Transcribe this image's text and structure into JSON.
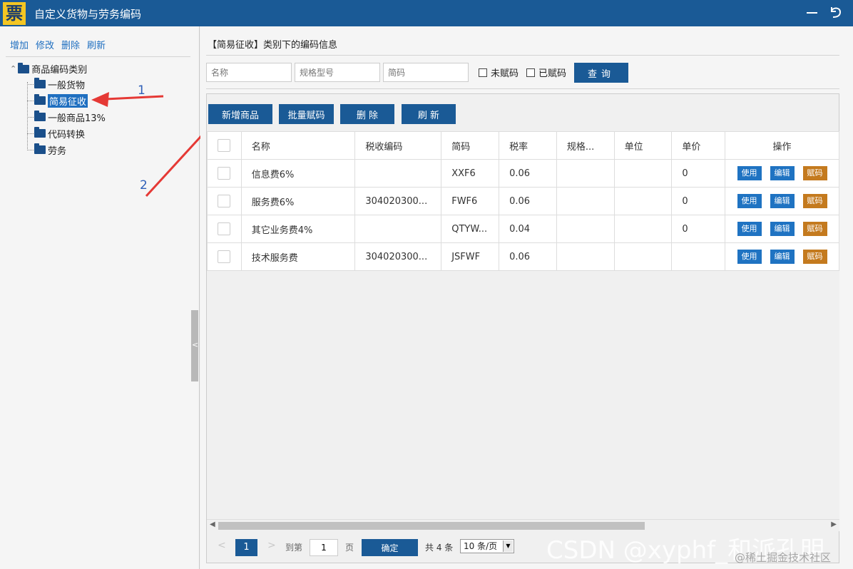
{
  "window": {
    "logo_char": "票",
    "title": "自定义货物与劳务编码"
  },
  "left": {
    "toolbar": [
      "增加",
      "修改",
      "删除",
      "刷新"
    ],
    "tree": {
      "root": "商品编码类别",
      "children": [
        "一般货物",
        "简易征收",
        "一般商品13%",
        "代码转换",
        "劳务"
      ],
      "selected_index": 1
    },
    "splitter_glyph": "<"
  },
  "annotations": {
    "label1": "1",
    "label2": "2"
  },
  "right": {
    "section_title": "【简易征收】类别下的编码信息",
    "filters": {
      "name_placeholder": "名称",
      "spec_placeholder": "规格型号",
      "code_placeholder": "简码",
      "unassigned_label": "未赋码",
      "assigned_label": "已赋码",
      "query_label": "查询"
    },
    "actions": {
      "add": "新增商品",
      "batch": "批量赋码",
      "delete": "删 除",
      "refresh": "刷 新"
    },
    "table": {
      "headers": [
        "名称",
        "税收编码",
        "简码",
        "税率",
        "规格...",
        "单位",
        "单价",
        "操作"
      ],
      "rows": [
        {
          "name": "信息费6%",
          "tax_code": "",
          "short": "XXF6",
          "rate": "0.06",
          "spec": "",
          "unit": "",
          "price": "0"
        },
        {
          "name": "服务费6%",
          "tax_code": "304020300...",
          "short": "FWF6",
          "rate": "0.06",
          "spec": "",
          "unit": "",
          "price": "0"
        },
        {
          "name": "其它业务费4%",
          "tax_code": "",
          "short": "QTYW...",
          "rate": "0.04",
          "spec": "",
          "unit": "",
          "price": "0"
        },
        {
          "name": "技术服务费",
          "tax_code": "304020300...",
          "short": "JSFWF",
          "rate": "0.06",
          "spec": "",
          "unit": "",
          "price": ""
        }
      ],
      "row_actions": {
        "use": "使用",
        "edit": "编辑",
        "assign": "赋码"
      }
    },
    "pager": {
      "current_page": "1",
      "goto_label": "到第",
      "goto_value": "1",
      "page_unit": "页",
      "confirm_label": "确定",
      "total_text": "共 4 条",
      "page_size": "10 条/页"
    }
  },
  "watermark": {
    "main": "CSDN @xyphf_和派孔明",
    "sub": "@稀土掘金技术社区"
  },
  "colors": {
    "titlebar": "#1a5a96",
    "primary_button": "#1a5a96",
    "link": "#1f6fc0",
    "action_blue": "#1f73c2",
    "action_brown": "#c47a1e",
    "annotation_arrow": "#e53935"
  }
}
